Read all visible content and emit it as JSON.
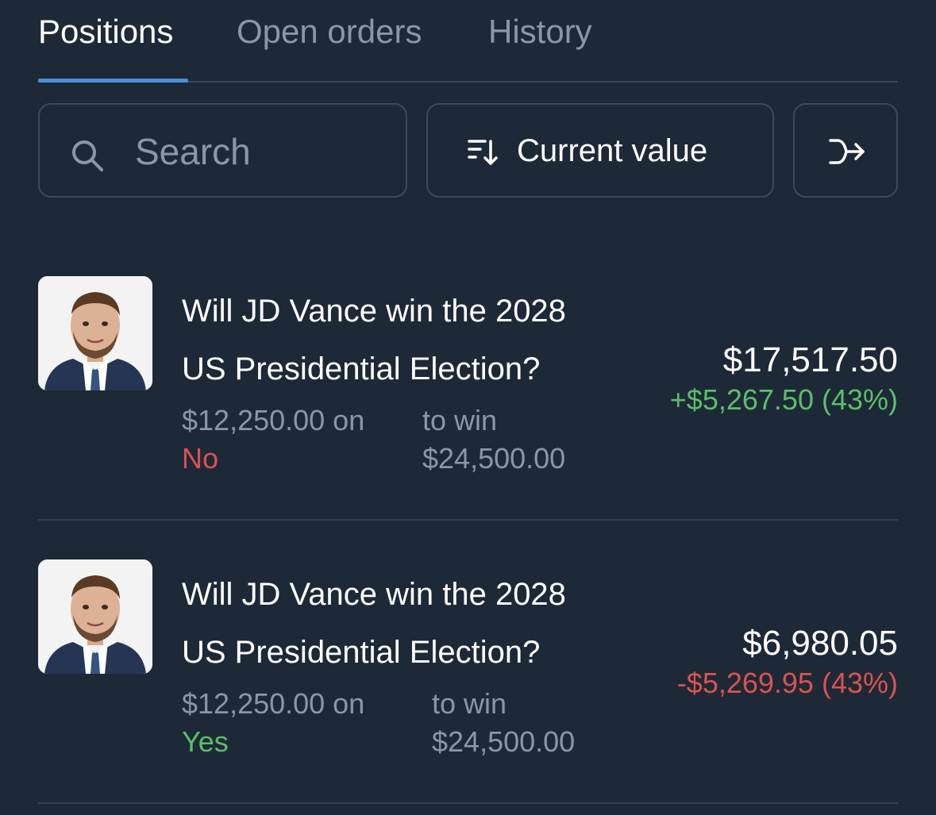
{
  "tabs": [
    {
      "label": "Positions",
      "active": true
    },
    {
      "label": "Open orders",
      "active": false
    },
    {
      "label": "History",
      "active": false
    }
  ],
  "toolbar": {
    "search_placeholder": "Search",
    "sort_label": "Current value"
  },
  "positions": [
    {
      "title_line1": "Will JD Vance win the 2028",
      "title_line2": "US Presidential Election?",
      "stake": "$12,250.00 on",
      "outcome": "No",
      "to_win_label": "to win",
      "to_win_value": "$24,500.00",
      "current_value": "$17,517.50",
      "pnl": "+$5,267.50 (43%)",
      "pnl_direction": "up"
    },
    {
      "title_line1": "Will JD Vance win the 2028",
      "title_line2": "US Presidential Election?",
      "stake": "$12,250.00 on",
      "outcome": "Yes",
      "to_win_label": "to win",
      "to_win_value": "$24,500.00",
      "current_value": "$6,980.05",
      "pnl": "-$5,269.95 (43%)",
      "pnl_direction": "down"
    }
  ],
  "colors": {
    "background": "#1e2937",
    "accent": "#4a90d9",
    "positive": "#5bbf6a",
    "negative": "#d9534f",
    "muted": "#8a97a8"
  }
}
